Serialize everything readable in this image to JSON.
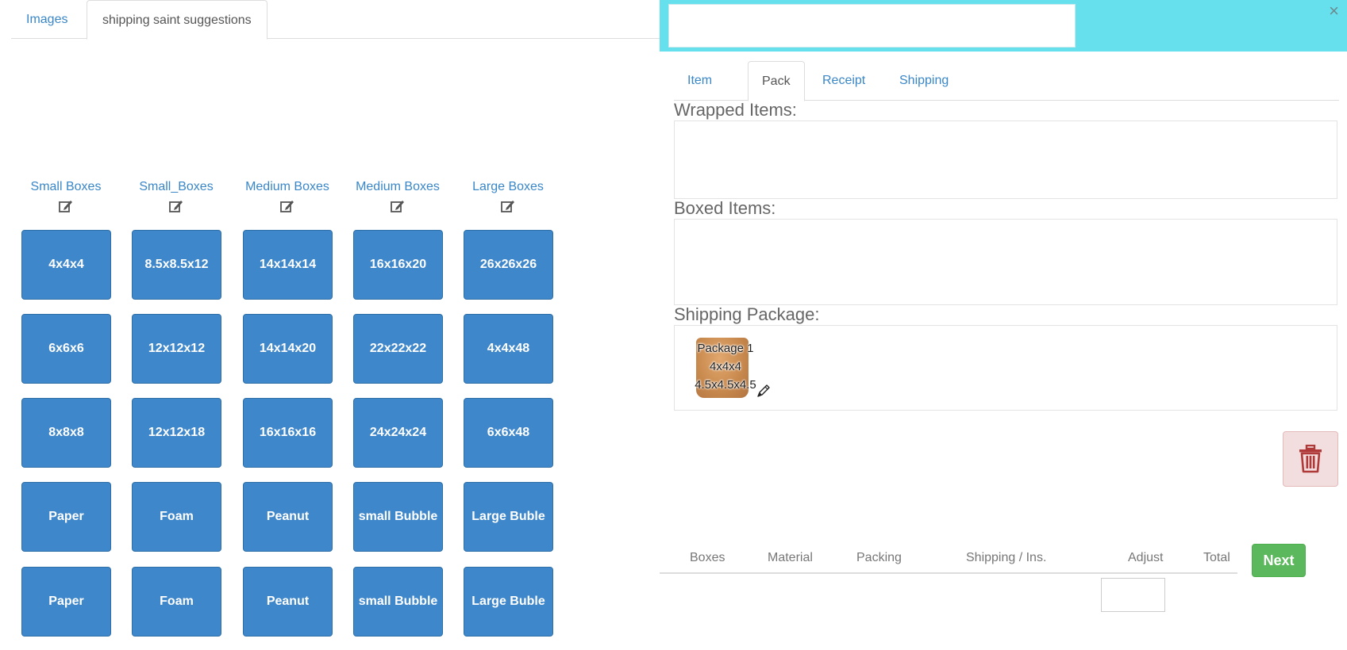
{
  "left_tabs": [
    {
      "label": "Images"
    },
    {
      "label": "shipping saint suggestions"
    }
  ],
  "columns": [
    {
      "title": "Small Boxes",
      "items": [
        "4x4x4",
        "6x6x6",
        "8x8x8",
        "Paper",
        "Paper"
      ]
    },
    {
      "title": "Small_Boxes",
      "items": [
        "8.5x8.5x12",
        "12x12x12",
        "12x12x18",
        "Foam",
        "Foam"
      ]
    },
    {
      "title": "Medium Boxes",
      "items": [
        "14x14x14",
        "14x14x20",
        "16x16x16",
        "Peanut",
        "Peanut"
      ]
    },
    {
      "title": "Medium Boxes",
      "items": [
        "16x16x20",
        "22x22x22",
        "24x24x24",
        "small Bubble",
        "small Bubble"
      ]
    },
    {
      "title": "Large Boxes",
      "items": [
        "26x26x26",
        "4x4x48",
        "6x6x48",
        "Large Buble",
        "Large Buble"
      ]
    }
  ],
  "right": {
    "close_label": "×",
    "tabs": [
      {
        "label": "Item"
      },
      {
        "label": "Pack"
      },
      {
        "label": "Receipt"
      },
      {
        "label": "Shipping"
      }
    ],
    "active_tab": "Pack",
    "wrapped_label": "Wrapped Items:",
    "boxed_label": "Boxed Items:",
    "shipping_label": "Shipping Package:",
    "package": {
      "name": "Package 1",
      "size": "4x4x4",
      "outer_size": "4.5x4.5x4.5"
    },
    "summary_headers": {
      "boxes": "Boxes",
      "material": "Material",
      "packing": "Packing",
      "shipping": "Shipping / Ins.",
      "adjust": "Adjust",
      "total": "Total"
    },
    "next_label": "Next"
  },
  "colors": {
    "primary_button": "#3f87cb",
    "link": "#3a87c8",
    "header_bar": "#67e0ee",
    "success": "#5cb85c",
    "danger_bg": "#f2dede",
    "danger_icon": "#b03a3a"
  },
  "icons": [
    "edit-icon",
    "pencil-icon",
    "trash-icon",
    "close-icon"
  ]
}
